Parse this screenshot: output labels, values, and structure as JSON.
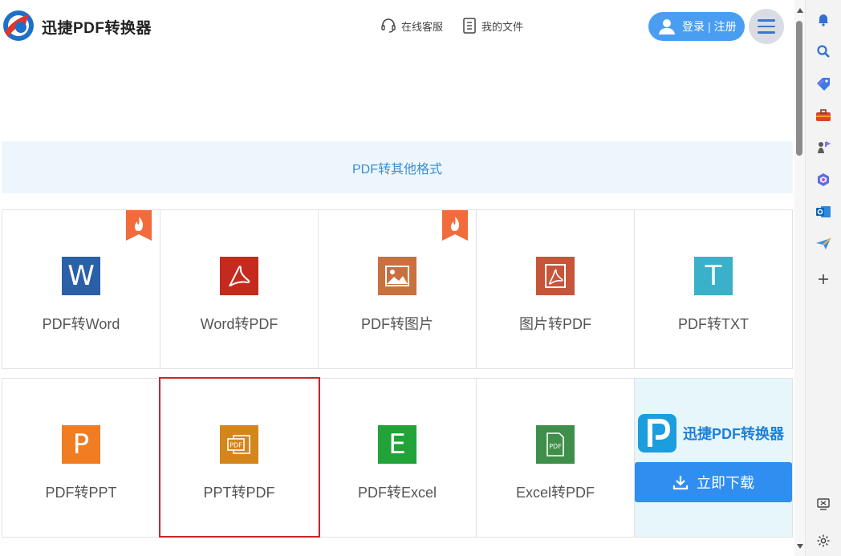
{
  "header": {
    "brand": "迅捷PDF转换器",
    "support_label": "在线客服",
    "files_label": "我的文件",
    "login_label": "登录",
    "register_label": "注册",
    "login_separator": "|"
  },
  "section": {
    "title": "PDF转其他格式"
  },
  "tools_row1": [
    {
      "label": "PDF转Word",
      "icon": "word-icon",
      "color": "#2b5fa8",
      "hot": true
    },
    {
      "label": "Word转PDF",
      "icon": "acrobat-icon",
      "color": "#c52a1e",
      "hot": false
    },
    {
      "label": "PDF转图片",
      "icon": "image-icon",
      "color": "#c8703e",
      "hot": true
    },
    {
      "label": "图片转PDF",
      "icon": "acrobat-icon",
      "color": "#c6553a",
      "hot": false
    },
    {
      "label": "PDF转TXT",
      "icon": "text-icon",
      "color": "#3bb0c9",
      "hot": false
    }
  ],
  "tools_row2": [
    {
      "label": "PDF转PPT",
      "icon": "powerpoint-icon",
      "color": "#f07d22"
    },
    {
      "label": "PPT转PDF",
      "icon": "ppt-pdf-icon",
      "color": "#d4861c"
    },
    {
      "label": "PDF转Excel",
      "icon": "excel-icon",
      "color": "#21a33a"
    },
    {
      "label": "Excel转PDF",
      "icon": "pdf-doc-icon",
      "color": "#3f8f4a"
    }
  ],
  "promo": {
    "name": "迅捷PDF转换器",
    "download_label": "立即下载"
  },
  "icons": {
    "W": "W",
    "P": "P",
    "E": "E",
    "T": "T",
    "pdf": "PDF"
  },
  "colors": {
    "accent": "#4a9ef2",
    "section_text": "#3b8ed0",
    "selection_border": "#c8272b",
    "hot_badge": "#f26b3a"
  }
}
